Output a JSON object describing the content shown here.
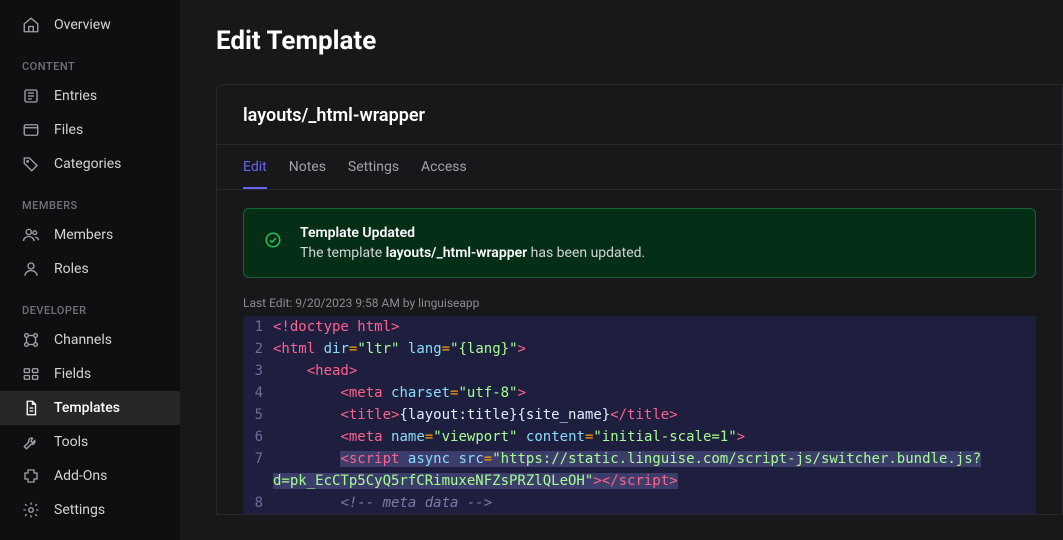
{
  "sidebar": {
    "overview": "Overview",
    "sections": {
      "content": "CONTENT",
      "members": "MEMBERS",
      "developer": "DEVELOPER"
    },
    "items": {
      "entries": "Entries",
      "files": "Files",
      "categories": "Categories",
      "members": "Members",
      "roles": "Roles",
      "channels": "Channels",
      "fields": "Fields",
      "templates": "Templates",
      "tools": "Tools",
      "addons": "Add-Ons",
      "settings": "Settings"
    }
  },
  "page": {
    "title": "Edit Template",
    "template_name": "layouts/_html-wrapper"
  },
  "tabs": {
    "edit": "Edit",
    "notes": "Notes",
    "settings": "Settings",
    "access": "Access"
  },
  "alert": {
    "title": "Template Updated",
    "prefix": "The template ",
    "name": "layouts/_html-wrapper",
    "suffix": " has been updated."
  },
  "meta": {
    "last_edit": "Last Edit: 9/20/2023 9:58 AM by linguiseapp"
  },
  "code": {
    "lines": [
      {
        "n": 1,
        "html": "<span class='tok-doctype'>&lt;!doctype html&gt;</span>"
      },
      {
        "n": 2,
        "html": "<span class='tok-tag'>&lt;html</span> <span class='tok-attr'>dir</span><span class='tok-op'>=</span><span class='tok-string'>\"ltr\"</span> <span class='tok-attr'>lang</span><span class='tok-op'>=</span><span class='tok-string'>\"{lang}\"</span><span class='tok-tag'>&gt;</span>"
      },
      {
        "n": 3,
        "html": "    <span class='tok-tag'>&lt;head&gt;</span>"
      },
      {
        "n": 4,
        "html": "        <span class='tok-tag'>&lt;meta</span> <span class='tok-attr'>charset</span><span class='tok-op'>=</span><span class='tok-string'>\"utf-8\"</span><span class='tok-tag'>&gt;</span>"
      },
      {
        "n": 5,
        "html": "        <span class='tok-tag'>&lt;title&gt;</span><span class='tok-text'>{layout:title}{site_name}</span><span class='tok-tag'>&lt;/title&gt;</span>"
      },
      {
        "n": 6,
        "html": "        <span class='tok-tag'>&lt;meta</span> <span class='tok-attr'>name</span><span class='tok-op'>=</span><span class='tok-string'>\"viewport\"</span> <span class='tok-attr'>content</span><span class='tok-op'>=</span><span class='tok-string'>\"initial-scale=1\"</span><span class='tok-tag'>&gt;</span>"
      },
      {
        "n": 7,
        "html": "        <span class='hl'><span class='tok-tag'>&lt;script</span> <span class='tok-attr'>async</span> <span class='tok-attr'>src</span><span class='tok-op'>=</span><span class='tok-string'>\"https://static.linguise.com/script-js/switcher.bundle.js?</span></span>",
        "wrap": "<span class='hl'><span class='tok-string'>d=pk_EcCTp5CyQ5rfCRimuxeNFZsPRZlQLeOH\"</span><span class='tok-tag'>&gt;&lt;/script&gt;</span></span>"
      },
      {
        "n": 8,
        "html": "        <span class='tok-comment'>&lt;!-- meta data --&gt;</span>"
      }
    ]
  }
}
